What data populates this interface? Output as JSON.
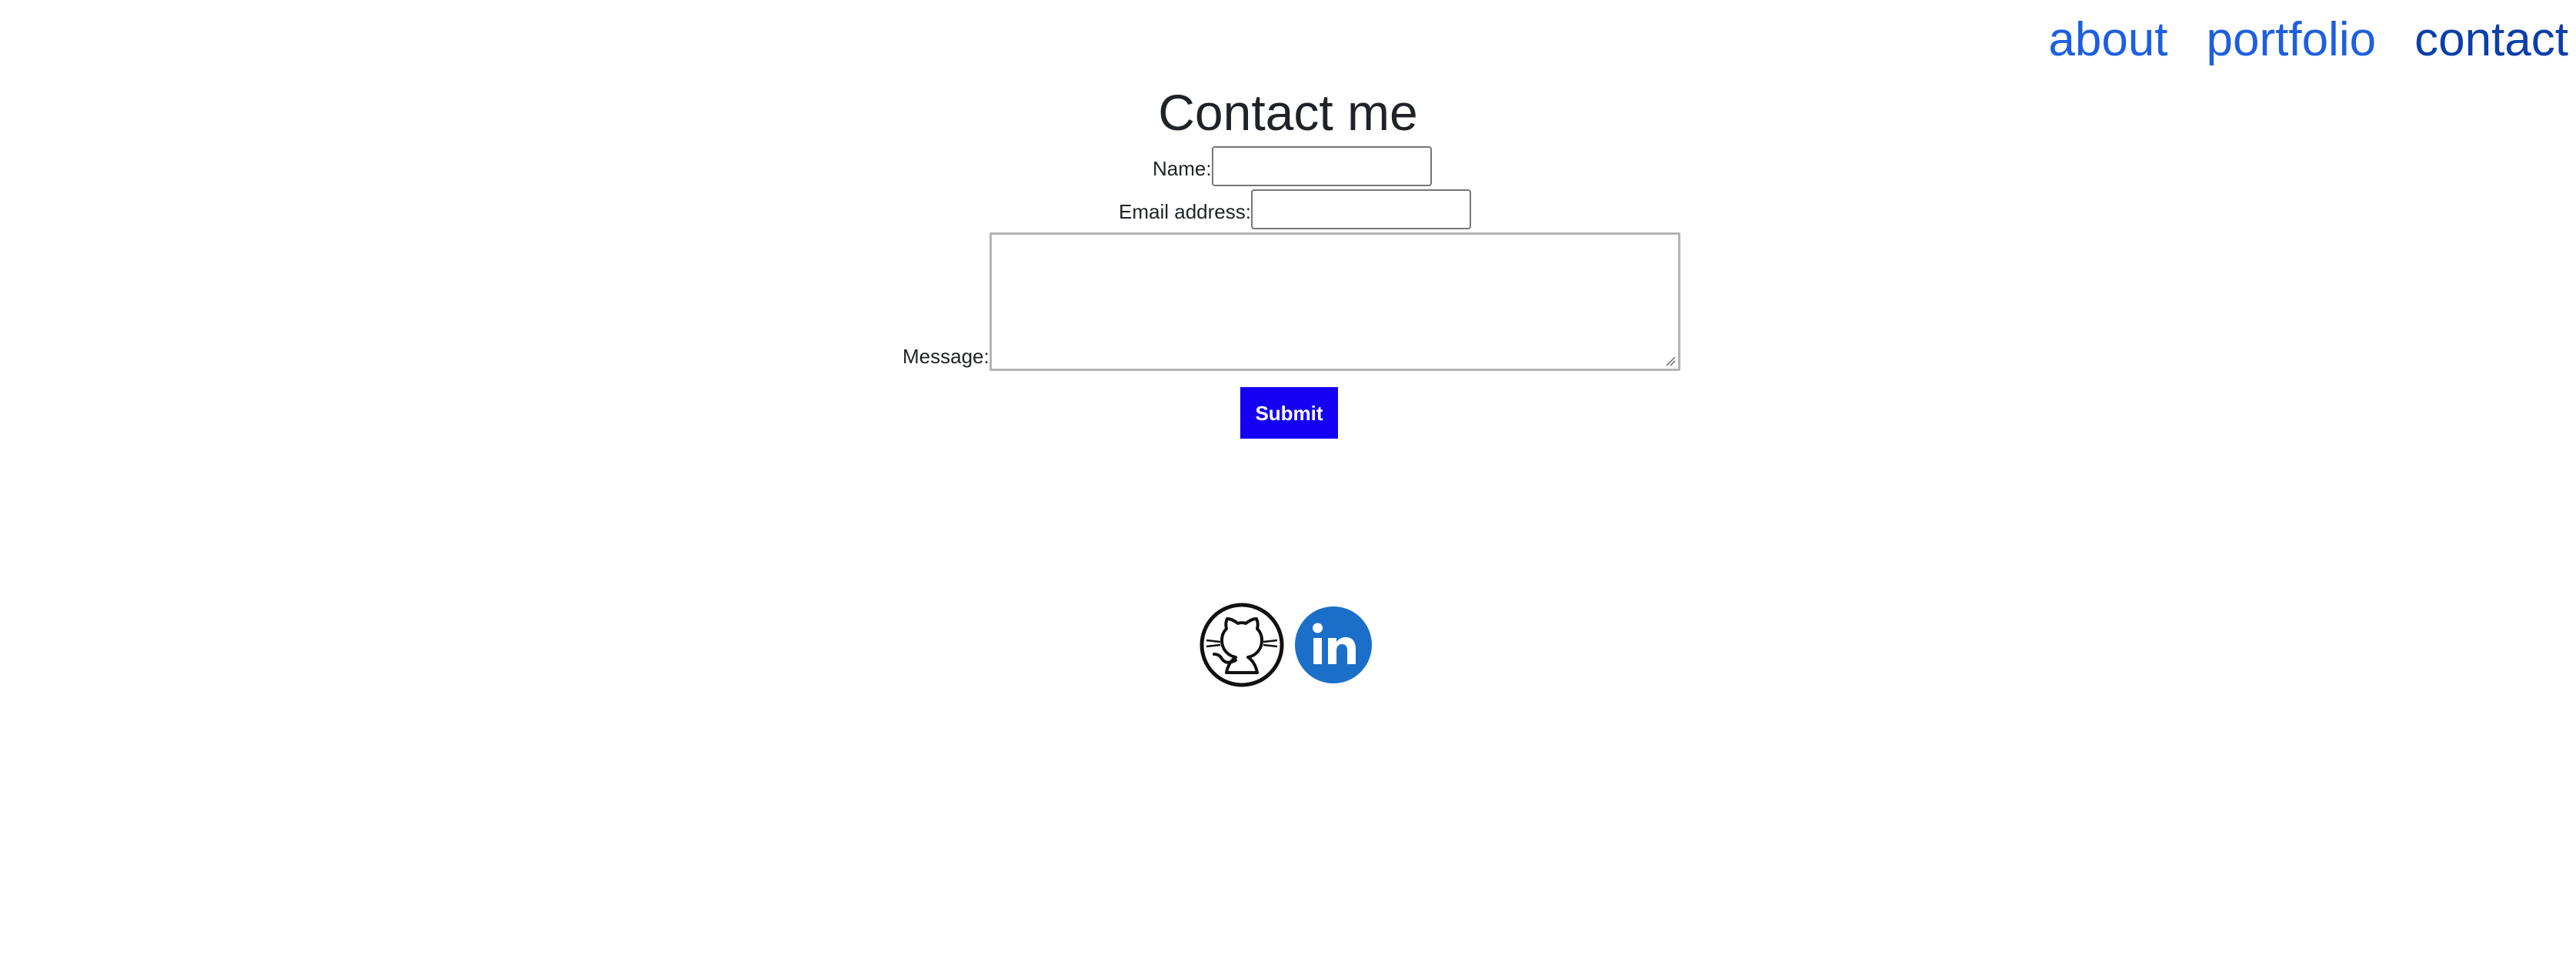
{
  "nav": {
    "items": [
      {
        "label": "about"
      },
      {
        "label": "portfolio"
      },
      {
        "label": "contact"
      }
    ],
    "active": "contact"
  },
  "page": {
    "title": "Contact me"
  },
  "form": {
    "name_label": "Name:",
    "name_value": "",
    "email_label": "Email address:",
    "email_value": "",
    "message_label": "Message:",
    "message_value": "",
    "submit_label": "Submit"
  },
  "social": {
    "icons": [
      "github-icon",
      "linkedin-icon"
    ],
    "linkedin_color": "#1b6fc9"
  },
  "colors": {
    "link": "#1d5fe0",
    "active_link": "#0b3fa9",
    "submit_bg": "#1500f3"
  }
}
